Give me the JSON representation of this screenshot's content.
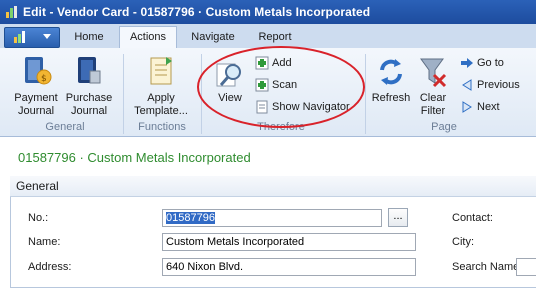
{
  "window": {
    "title": "Edit - Vendor Card - 01587796 · Custom Metals Incorporated"
  },
  "tabs": [
    "Home",
    "Actions",
    "Navigate",
    "Report"
  ],
  "ribbon": {
    "payment_journal": "Payment Journal",
    "purchase_journal": "Purchase Journal",
    "group_general": "General",
    "apply_template": "Apply Template...",
    "group_functions": "Functions",
    "view": "View",
    "add": "Add",
    "scan": "Scan",
    "show_navigator": "Show Navigator",
    "group_therefore": "Therefore",
    "refresh": "Refresh",
    "clear_filter": "Clear Filter",
    "go_to": "Go to",
    "previous": "Previous",
    "next": "Next",
    "group_page": "Page"
  },
  "page": {
    "heading": "01587796 · Custom Metals Incorporated",
    "section": "General",
    "fields": {
      "no_label": "No.:",
      "no_value": "01587796",
      "name_label": "Name:",
      "name_value": "Custom Metals Incorporated",
      "address_label": "Address:",
      "address_value": "640 Nixon Blvd.",
      "contact_label": "Contact:",
      "city_label": "City:",
      "search_name_label": "Search Name:"
    },
    "lookup_label": "..."
  },
  "colors": {
    "title_bar": "#1d4c9e",
    "annotation": "#d9222a",
    "heading": "#2f8c2f"
  }
}
